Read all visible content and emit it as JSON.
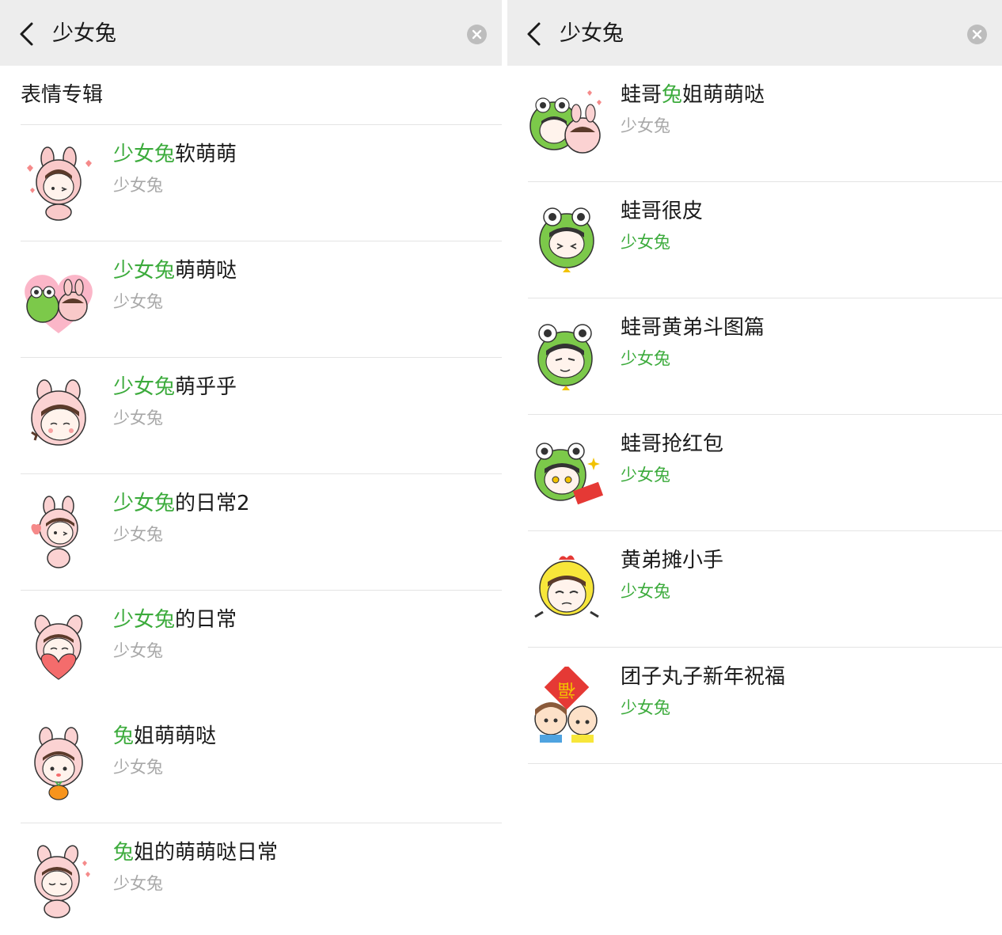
{
  "left": {
    "query": "少女兔",
    "section_title": "表情专辑",
    "items": [
      {
        "hl": "少女兔",
        "rest": "软萌萌",
        "author": "少女兔"
      },
      {
        "hl": "少女兔",
        "rest": "萌萌哒",
        "author": "少女兔"
      },
      {
        "hl": "少女兔",
        "rest": "萌乎乎",
        "author": "少女兔"
      },
      {
        "hl": "少女兔",
        "rest": "的日常2",
        "author": "少女兔"
      },
      {
        "hl": "少女兔",
        "rest": "的日常",
        "author": "少女兔"
      },
      {
        "hl": "兔",
        "rest": "姐萌萌哒",
        "author": "少女兔"
      },
      {
        "hl": "兔",
        "rest": "姐的萌萌哒日常",
        "author": "少女兔"
      }
    ]
  },
  "right": {
    "query": "少女兔",
    "items": [
      {
        "pre": "蛙哥",
        "hl": "兔",
        "rest": "姐萌萌哒",
        "author": "少女兔"
      },
      {
        "pre": "蛙哥很皮",
        "hl": "",
        "rest": "",
        "author": "少女兔"
      },
      {
        "pre": "蛙哥黄弟斗图篇",
        "hl": "",
        "rest": "",
        "author": "少女兔"
      },
      {
        "pre": "蛙哥抢红包",
        "hl": "",
        "rest": "",
        "author": "少女兔"
      },
      {
        "pre": "黄弟摊小手",
        "hl": "",
        "rest": "",
        "author": "少女兔"
      },
      {
        "pre": "团子丸子新年祝福",
        "hl": "",
        "rest": "",
        "author": "少女兔"
      }
    ]
  },
  "colors": {
    "highlight": "#3cab3c",
    "search_bg": "#ededed",
    "subtitle_gray": "#a8a8a8"
  },
  "icons": [
    "back-chevron-icon",
    "clear-icon"
  ]
}
